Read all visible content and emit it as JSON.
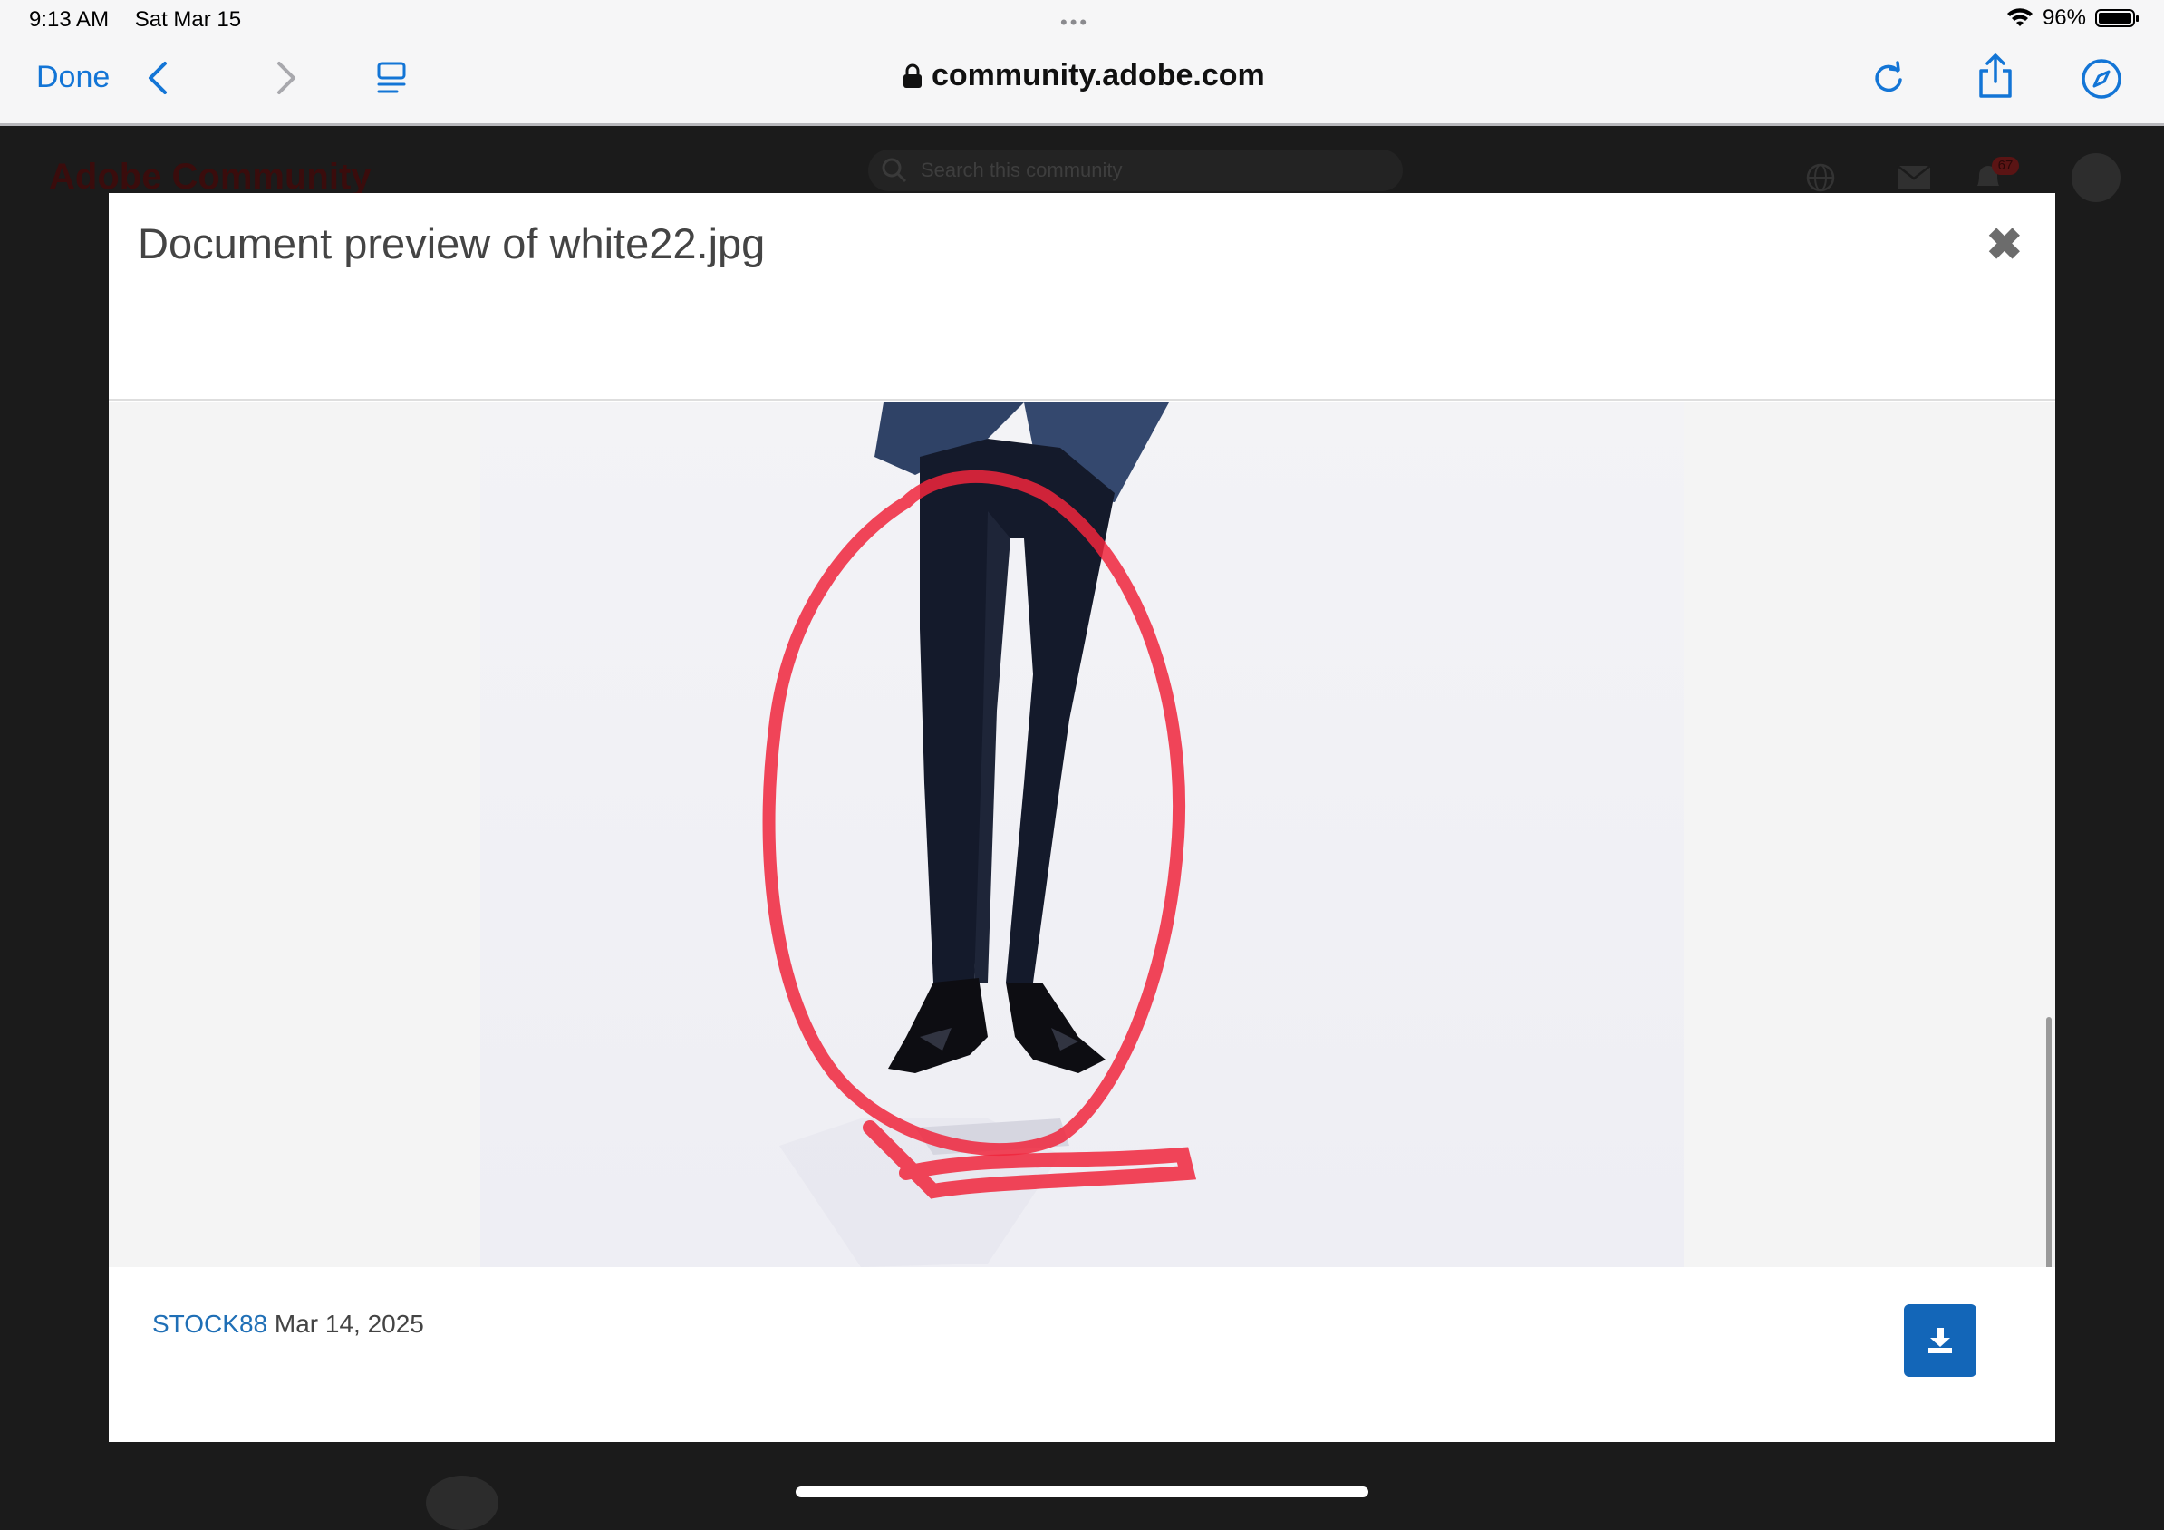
{
  "status_bar": {
    "time": "9:13 AM",
    "date": "Sat Mar 15",
    "battery": "96%"
  },
  "browser": {
    "done_label": "Done",
    "url": "community.adobe.com",
    "icons": [
      "chevron-left-icon",
      "chevron-right-icon",
      "tabs-icon",
      "lock-icon",
      "reload-icon",
      "share-icon",
      "compass-icon"
    ]
  },
  "background_page": {
    "logo": "Adobe Community",
    "search_placeholder": "Search this community",
    "notification_count": "67"
  },
  "modal": {
    "title": "Document preview of white22.jpg",
    "close_label": "✖",
    "footer": {
      "author": "STOCK88",
      "date": "Mar 14, 2025"
    }
  },
  "colors": {
    "link": "#1f6fb6",
    "accent": "#1366b8",
    "annotation": "#f0263c",
    "browser_blue": "#1375d6"
  }
}
